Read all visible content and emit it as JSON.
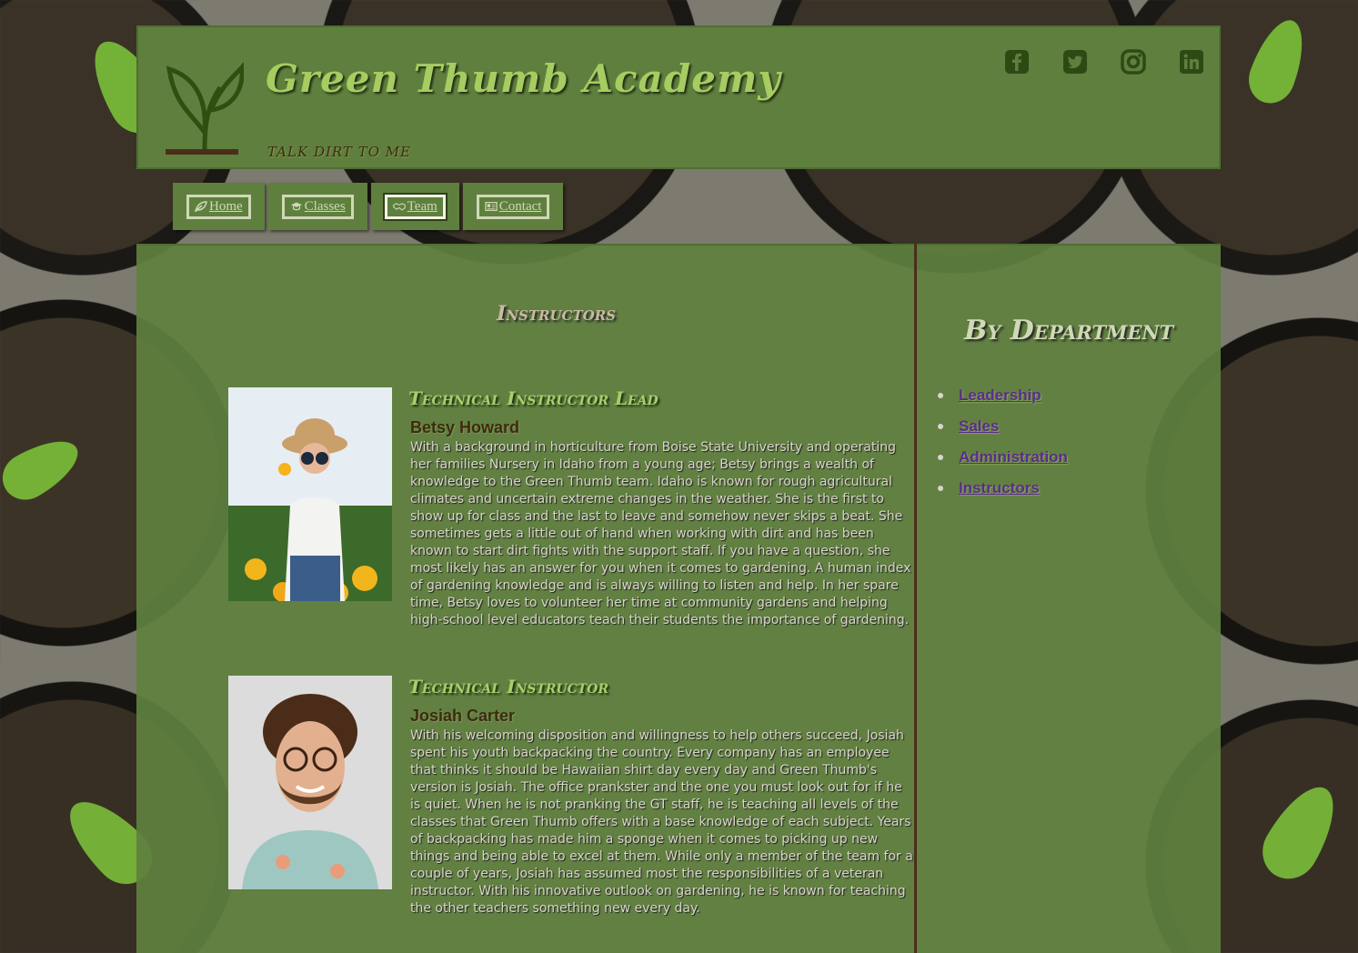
{
  "brand": {
    "title": "Green Thumb Academy",
    "tagline": "talk dirt to me"
  },
  "social": [
    "facebook-icon",
    "twitter-icon",
    "instagram-icon",
    "linkedin-icon"
  ],
  "nav": {
    "items": [
      {
        "label": "Home",
        "icon": "leaf-icon"
      },
      {
        "label": "Classes",
        "icon": "graduation-cap-icon"
      },
      {
        "label": "Team",
        "icon": "handshake-icon",
        "active": true
      },
      {
        "label": "Contact",
        "icon": "address-card-icon"
      }
    ]
  },
  "main": {
    "heading": "Instructors",
    "instructors": [
      {
        "role": "Technical Instructor Lead",
        "name": "Betsy Howard",
        "bio": "With a background in horticulture from Boise State University and operating her families Nursery in Idaho from a young age; Betsy brings a wealth of knowledge to the Green Thumb team. Idaho is known for rough agricultural climates and uncertain extreme changes in the weather. She is the first to show up for class and the last to leave and somehow never skips a beat. She sometimes gets a little out of hand when working with dirt and has been known to start dirt fights with the support staff. If you have a question, she most likely has an answer for you when it comes to gardening. A human index of gardening knowledge and is always willing to listen and help. In her spare time, Betsy loves to volunteer her time at community gardens and helping high-school level educators teach their students the importance of gardening."
      },
      {
        "role": "Technical Instructor",
        "name": "Josiah Carter",
        "bio": "With his welcoming disposition and willingness to help others succeed, Josiah spent his youth backpacking the country. Every company has an employee that thinks it should be Hawaiian shirt day every day and Green Thumb's version is Josiah. The office prankster and the one you must look out for if he is quiet. When he is not pranking the GT staff, he is teaching all levels of the classes that Green Thumb offers with a base knowledge of each subject. Years of backpacking has made him a sponge when it comes to picking up new things and being able to excel at them. While only a member of the team for a couple of years, Josiah has assumed most the responsibilities of a veteran instructor. With his innovative outlook on gardening, he is known for teaching the other teachers something new every day."
      }
    ]
  },
  "aside": {
    "heading": "By Department",
    "departments": [
      "Leadership",
      "Sales",
      "Administration",
      "Instructors"
    ]
  },
  "colors": {
    "panel": "#5f7f3e",
    "title": "#a6cc62",
    "link": "#5b2c8c",
    "divider": "#4a2e1a"
  }
}
